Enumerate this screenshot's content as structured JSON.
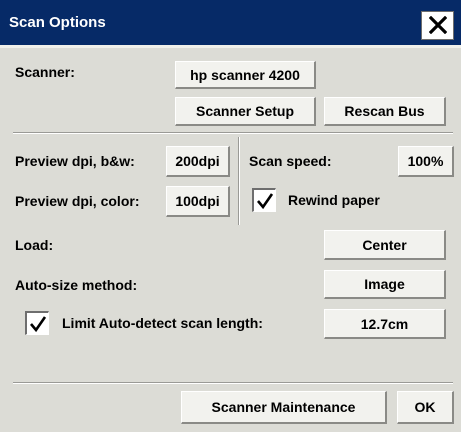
{
  "window": {
    "title": "Scan Options",
    "close_icon": "close-icon"
  },
  "scanner": {
    "label": "Scanner:",
    "value": "hp scanner 4200",
    "setup_button": "Scanner Setup",
    "rescan_button": "Rescan Bus"
  },
  "preview": {
    "bw_label": "Preview dpi, b&w:",
    "bw_value": "200dpi",
    "color_label": "Preview dpi, color:",
    "color_value": "100dpi"
  },
  "scan_speed": {
    "label": "Scan speed:",
    "value": "100%"
  },
  "rewind_paper": {
    "label": "Rewind paper",
    "checked": true
  },
  "load": {
    "label": "Load:",
    "value": "Center"
  },
  "auto_size": {
    "label": "Auto-size method:",
    "value": "Image"
  },
  "limit_auto_detect": {
    "label": "Limit Auto-detect scan length:",
    "checked": true,
    "value": "12.7cm"
  },
  "footer": {
    "maintenance_button": "Scanner Maintenance",
    "ok_button": "OK"
  },
  "colors": {
    "titlebar": "#062a67",
    "dialog_bg": "#dcdcd6",
    "button_bg": "#f2f2ee"
  }
}
